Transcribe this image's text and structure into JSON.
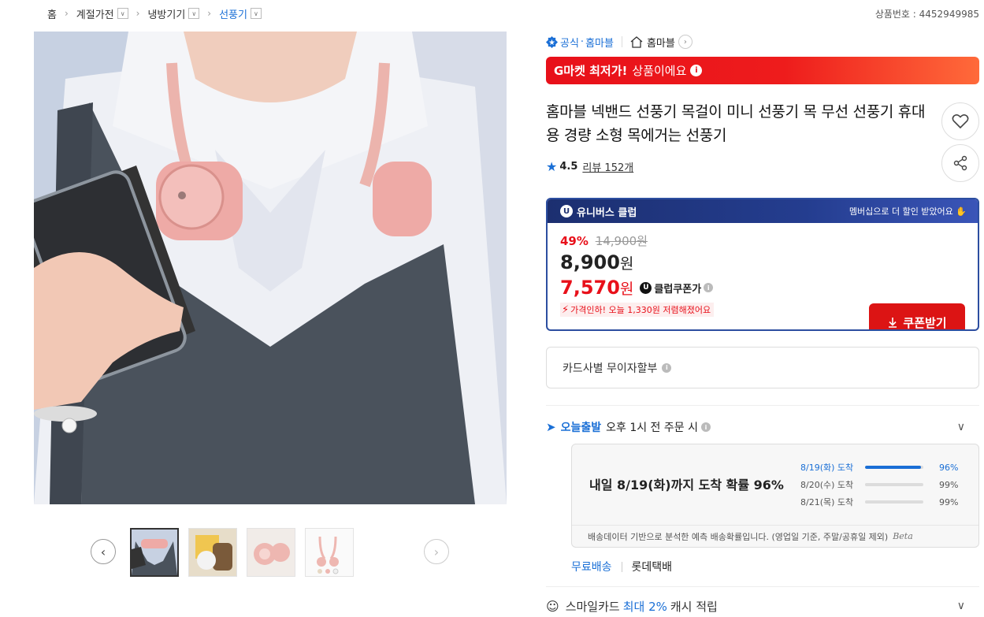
{
  "breadcrumb": {
    "items": [
      "홈",
      "계절가전",
      "냉방기기",
      "선풍기"
    ]
  },
  "product_no": "상품번호 : 4452949985",
  "gallery": {
    "prev_icon": "chevron-left-icon",
    "next_icon": "chevron-right-icon",
    "thumb_count": 4
  },
  "shop": {
    "official_label": "공식",
    "official_shop": "홈마블",
    "shop_name": "홈마블"
  },
  "banner": {
    "bold": "G마켓 최저가!",
    "text": "상품이에요"
  },
  "title": "홈마블 넥밴드 선풍기 목걸이 미니 선풍기 목 무선 선풍기 휴대용 경량 소형 목에거는 선풍기",
  "rating": {
    "score": "4.5",
    "reviews": "리뷰 152개"
  },
  "club": {
    "name": "유니버스 클럽",
    "promo": "멤버십으로 더 할인 받았어요",
    "discount_pct": "49%",
    "original_price": "14,900원",
    "price_number": "8,900",
    "price_unit": "원",
    "coupon_price_number": "7,570",
    "coupon_price_unit": "원",
    "coupon_label": "클럽쿠폰가",
    "drop_note": "가격인하! 오늘 1,330원 저렴해졌어요",
    "coupon_button": "쿠폰받기"
  },
  "installment": "카드사별 무이자할부",
  "delivery": {
    "today_label": "오늘출발",
    "today_condition": "오후 1시 전 주문 시",
    "headline": "내일 8/19(화)까지 도착 확률 96%",
    "probabilities": [
      {
        "date": "8/19(화) 도착",
        "pct_text": "96%",
        "pct": 96
      },
      {
        "date": "8/20(수) 도착",
        "pct_text": "99%",
        "pct": 99
      },
      {
        "date": "8/21(목) 도착",
        "pct_text": "99%",
        "pct": 99
      }
    ],
    "note": "배송데이터 기반으로 분석한 예측 배송확률입니다. (영업일 기준, 주말/공휴일 제외)",
    "beta": "Beta"
  },
  "shipping": {
    "fee": "무료배송",
    "carrier": "롯데택배"
  },
  "smile_card": {
    "prefix": "스마일카드",
    "highlight": "최대 2%",
    "suffix": "캐시 적립"
  },
  "colors": {
    "accent_blue": "#1a6fd6",
    "sale_red": "#e8101a",
    "club_navy": "#1c2f70"
  }
}
